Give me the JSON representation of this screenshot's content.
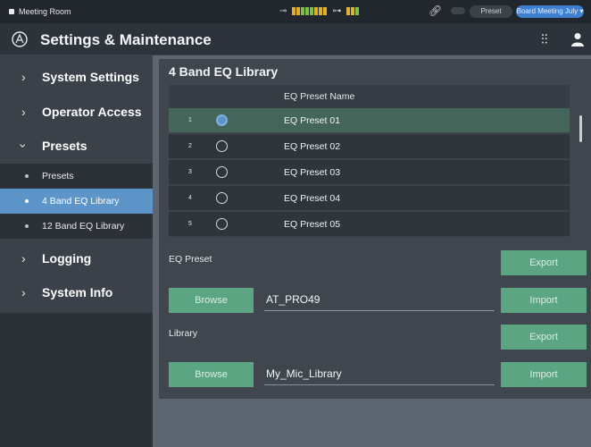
{
  "status_bar": {
    "room_name": "Meeting Room",
    "preset_label": "Preset",
    "preset_value": "Board Meeting July",
    "meter_colors": [
      "#e0b030",
      "#e0b030",
      "#7cc04a",
      "#7cc04a",
      "#7cc04a",
      "#e0b030"
    ]
  },
  "header": {
    "title": "Settings & Maintenance"
  },
  "sidebar": {
    "items": [
      {
        "label": "System Settings",
        "expanded": false
      },
      {
        "label": "Operator Access",
        "expanded": false
      },
      {
        "label": "Presets",
        "expanded": true
      },
      {
        "label": "Logging",
        "expanded": false
      },
      {
        "label": "System Info",
        "expanded": false
      }
    ],
    "sub_items": [
      {
        "label": "Presets",
        "active": false
      },
      {
        "label": "4 Band EQ Library",
        "active": true
      },
      {
        "label": "12 Band EQ Library",
        "active": false
      }
    ]
  },
  "main": {
    "title": "4 Band EQ Library",
    "table": {
      "column_header": "EQ Preset Name",
      "rows": [
        {
          "num": "1",
          "name": "EQ Preset 01",
          "selected": true
        },
        {
          "num": "2",
          "name": "EQ Preset 02",
          "selected": false
        },
        {
          "num": "3",
          "name": "EQ Preset 03",
          "selected": false
        },
        {
          "num": "4",
          "name": "EQ Preset 04",
          "selected": false
        },
        {
          "num": "5",
          "name": "EQ Preset 05",
          "selected": false
        }
      ]
    },
    "eq_preset": {
      "label": "EQ Preset",
      "export_label": "Export",
      "browse_label": "Browse",
      "file_value": "AT_PRO49",
      "import_label": "Import"
    },
    "library": {
      "label": "Library",
      "export_label": "Export",
      "browse_label": "Browse",
      "file_value": "My_Mic_Library",
      "import_label": "Import"
    }
  },
  "colors": {
    "accent_blue": "#5e95c9",
    "button_green": "#5ba582",
    "selected_row": "#44665a"
  }
}
